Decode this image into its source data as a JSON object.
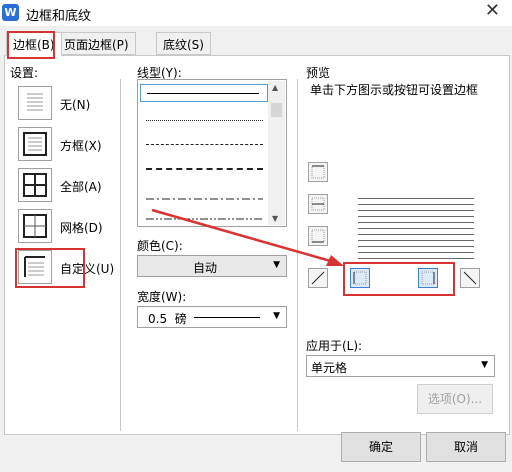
{
  "window": {
    "app_icon": "W",
    "title": "边框和底纹"
  },
  "tabs": [
    {
      "label": "边框(B)"
    },
    {
      "label": "页面边框(P)"
    },
    {
      "label": "底纹(S)"
    }
  ],
  "settings": {
    "label": "设置:",
    "items": [
      {
        "label": "无(N)",
        "icon": "none-border-icon"
      },
      {
        "label": "方框(X)",
        "icon": "box-border-icon"
      },
      {
        "label": "全部(A)",
        "icon": "all-border-icon"
      },
      {
        "label": "网格(D)",
        "icon": "grid-border-icon"
      },
      {
        "label": "自定义(U)",
        "icon": "custom-border-icon"
      }
    ]
  },
  "line_style": {
    "label": "线型(Y):"
  },
  "color": {
    "label": "颜色(C):",
    "value": "自动"
  },
  "width": {
    "label": "宽度(W):",
    "value": "0.5  磅"
  },
  "preview": {
    "label": "预览",
    "hint": "单击下方图示或按钮可设置边框"
  },
  "apply_to": {
    "label": "应用于(L):",
    "value": "单元格"
  },
  "buttons": {
    "options": "选项(O)...",
    "ok": "确定",
    "cancel": "取消"
  },
  "colors": {
    "annotation": "#d83333",
    "accent": "#2b6fd6"
  }
}
